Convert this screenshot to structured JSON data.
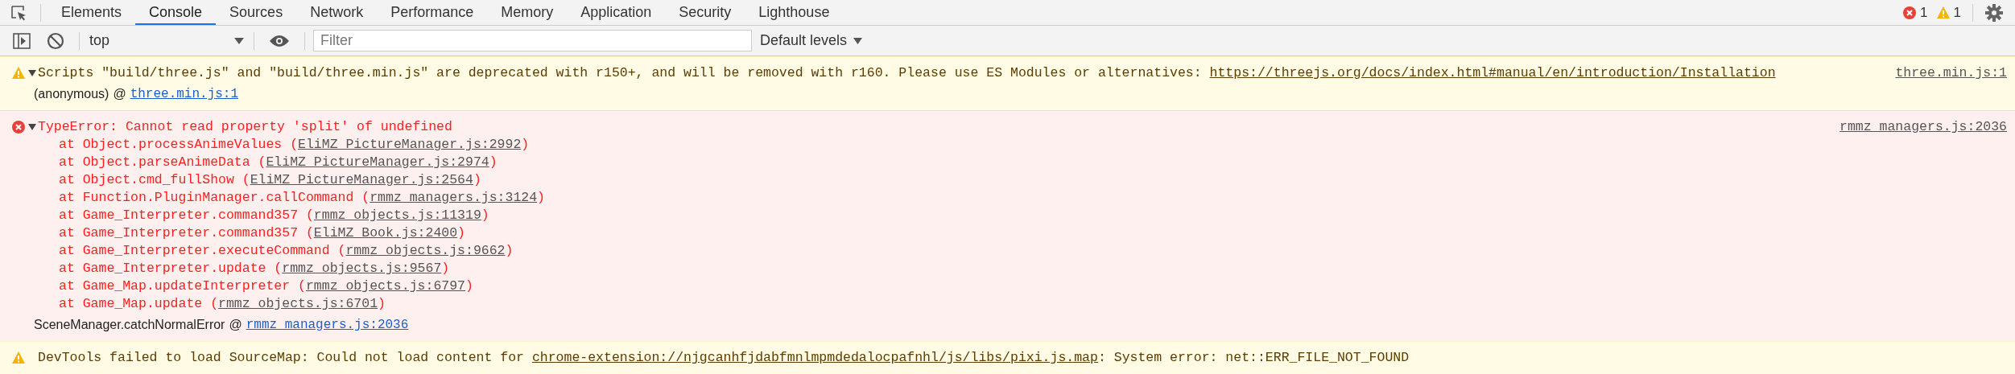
{
  "tabs": [
    {
      "label": "Elements",
      "selected": false
    },
    {
      "label": "Console",
      "selected": true
    },
    {
      "label": "Sources",
      "selected": false
    },
    {
      "label": "Network",
      "selected": false
    },
    {
      "label": "Performance",
      "selected": false
    },
    {
      "label": "Memory",
      "selected": false
    },
    {
      "label": "Application",
      "selected": false
    },
    {
      "label": "Security",
      "selected": false
    },
    {
      "label": "Lighthouse",
      "selected": false
    }
  ],
  "counts": {
    "errors": "1",
    "warnings": "1"
  },
  "toolbar": {
    "context": "top",
    "filter_placeholder": "Filter",
    "levels": "Default levels"
  },
  "messages": [
    {
      "kind": "warning",
      "expanded": true,
      "source": "three.min.js:1",
      "parts": [
        {
          "text": "Scripts \"build/three.js\" and \"build/three.min.js\" are deprecated with r150+, and will be removed with r160. Please use ES Modules or alternatives: "
        },
        {
          "link": "https://threejs.org/docs/index.html#manual/en/introduction/Installation"
        }
      ],
      "caller": {
        "text": "(anonymous)",
        "at": "@",
        "link": "three.min.js:1"
      }
    },
    {
      "kind": "error",
      "expanded": true,
      "source": "rmmz_managers.js:2036",
      "parts": [
        {
          "text": "TypeError: Cannot read property 'split' of undefined"
        }
      ],
      "trace": [
        [
          {
            "text": "at Object.processAnimeValues ("
          },
          {
            "link": "EliMZ_PictureManager.js:2992"
          },
          {
            "text": ")"
          }
        ],
        [
          {
            "text": "at Object.parseAnimeData ("
          },
          {
            "link": "EliMZ_PictureManager.js:2974"
          },
          {
            "text": ")"
          }
        ],
        [
          {
            "text": "at Object.cmd_fullShow ("
          },
          {
            "link": "EliMZ_PictureManager.js:2564"
          },
          {
            "text": ")"
          }
        ],
        [
          {
            "text": "at Function.PluginManager.callCommand ("
          },
          {
            "link": "rmmz_managers.js:3124"
          },
          {
            "text": ")"
          }
        ],
        [
          {
            "text": "at Game_Interpreter.command357 ("
          },
          {
            "link": "rmmz_objects.js:11319"
          },
          {
            "text": ")"
          }
        ],
        [
          {
            "text": "at Game_Interpreter.command357 ("
          },
          {
            "link": "EliMZ_Book.js:2400"
          },
          {
            "text": ")"
          }
        ],
        [
          {
            "text": "at Game_Interpreter.executeCommand ("
          },
          {
            "link": "rmmz_objects.js:9662"
          },
          {
            "text": ")"
          }
        ],
        [
          {
            "text": "at Game_Interpreter.update ("
          },
          {
            "link": "rmmz_objects.js:9567"
          },
          {
            "text": ")"
          }
        ],
        [
          {
            "text": "at Game_Map.updateInterpreter ("
          },
          {
            "link": "rmmz_objects.js:6797"
          },
          {
            "text": ")"
          }
        ],
        [
          {
            "text": "at Game_Map.update ("
          },
          {
            "link": "rmmz_objects.js:6701"
          },
          {
            "text": ")"
          }
        ]
      ],
      "caller": {
        "text": "SceneManager.catchNormalError",
        "at": "@",
        "link": "rmmz_managers.js:2036"
      }
    },
    {
      "kind": "warning",
      "parts": [
        {
          "text": "DevTools failed to load SourceMap: Could not load content for "
        },
        {
          "link": "chrome-extension://njgcanhfjdabfmnlmpmdedalocpafnhl/js/libs/pixi.js.map"
        },
        {
          "text": ": System error: net::ERR_FILE_NOT_FOUND"
        }
      ]
    }
  ]
}
